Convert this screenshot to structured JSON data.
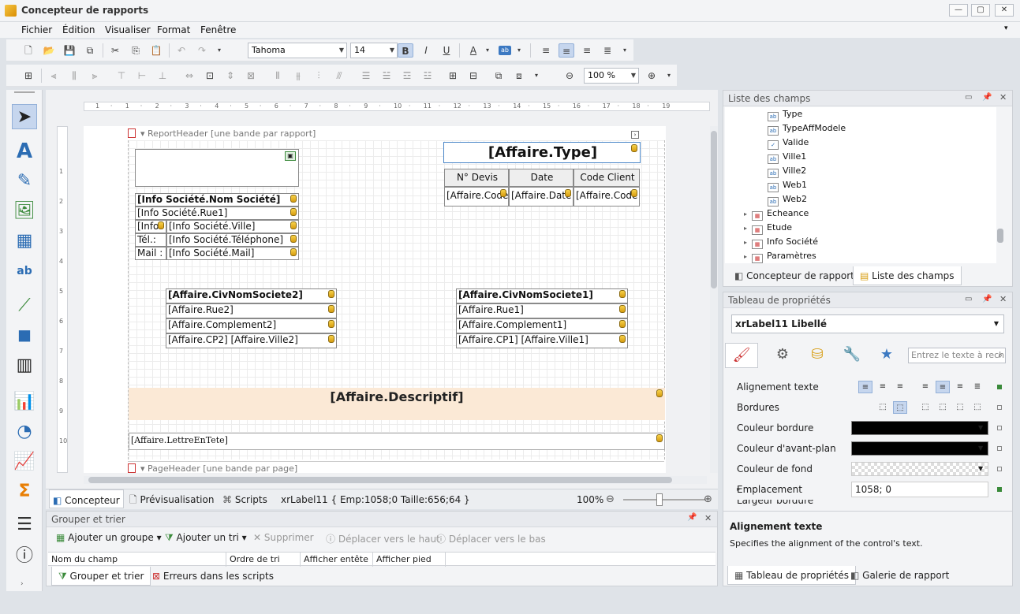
{
  "window": {
    "title": "Concepteur de rapports"
  },
  "menu": [
    "Fichier",
    "Édition",
    "Visualiser",
    "Format",
    "Fenêtre"
  ],
  "toolbar": {
    "font": "Tahoma",
    "size": "14",
    "zoom": "100 %"
  },
  "bands": {
    "report_header": "ReportHeader [une bande par rapport]",
    "page_header": "PageHeader [une bande par page]"
  },
  "report": {
    "title": "[Affaire.Type]",
    "table_headers": [
      "N° Devis",
      "Date",
      "Code Client"
    ],
    "table_cells": [
      "[Affaire.Code",
      "[Affaire.Date",
      "[Affaire.Code"
    ],
    "company": [
      "[Info Société.Nom Société]",
      "[Info Société.Rue1]",
      "[Info",
      "[Info Société.Ville]",
      "Tél.:",
      "[Info Société.Téléphone]",
      "Mail :",
      "[Info Société.Mail]"
    ],
    "left_addr": [
      "[Affaire.CivNomSociete2]",
      "[Affaire.Rue2]",
      "[Affaire.Complement2]",
      "[Affaire.CP2] [Affaire.Ville2]"
    ],
    "right_addr": [
      "[Affaire.CivNomSociete1]",
      "[Affaire.Rue1]",
      "[Affaire.Complement1]",
      "[Affaire.CP1] [Affaire.Ville1]"
    ],
    "descriptif": "[Affaire.Descriptif]",
    "lettre": "[Affaire.LettreEnTete]"
  },
  "status": {
    "tabs": [
      "Concepteur",
      "Prévisualisation",
      "Scripts"
    ],
    "info": "xrLabel11 { Emp:1058;0 Taille:656;64 }",
    "zoom": "100%"
  },
  "group_sort": {
    "title": "Grouper et trier",
    "actions": [
      "Ajouter un groupe",
      "Ajouter un tri",
      "Supprimer",
      "Déplacer vers le haut",
      "Déplacer vers le bas"
    ],
    "columns": [
      "Nom du champ",
      "Ordre de tri",
      "Afficher entête",
      "Afficher pied"
    ],
    "tabs": [
      "Grouper et trier",
      "Erreurs dans les scripts"
    ]
  },
  "field_list": {
    "title": "Liste des champs",
    "fields": [
      "Type",
      "TypeAffModele",
      "Valide",
      "Ville1",
      "Ville2",
      "Web1",
      "Web2"
    ],
    "tables": [
      "Echeance",
      "Etude",
      "Info Société",
      "Paramètres"
    ],
    "tabs": [
      "Concepteur de rapports",
      "Liste des champs"
    ]
  },
  "props": {
    "title": "Tableau de propriétés",
    "selected": "xrLabel11   Libellé",
    "search_placeholder": "Entrez le texte à rech",
    "rows": [
      "Alignement texte",
      "Bordures",
      "Couleur bordure",
      "Couleur d'avant-plan",
      "Couleur de fond",
      "Emplacement",
      "Largeur bordure"
    ],
    "emplacement": "1058; 0",
    "desc_title": "Alignement texte",
    "desc_text": "Specifies the alignment of the control's text.",
    "tabs": [
      "Tableau de propriétés",
      "Galerie de rapport"
    ]
  },
  "ruler_h": [
    "1",
    "·",
    "1",
    "·",
    "2",
    "·",
    "3",
    "·",
    "4",
    "·",
    "5",
    "·",
    "6",
    "·",
    "7",
    "·",
    "8",
    "·",
    "9",
    "·",
    "10",
    "·",
    "11",
    "·",
    "12",
    "·",
    "13",
    "·",
    "14",
    "·",
    "15",
    "·",
    "16",
    "·",
    "17",
    "·",
    "18",
    "·",
    "19"
  ],
  "ruler_v": [
    "1",
    "2",
    "3",
    "4",
    "5",
    "6",
    "7",
    "8",
    "9",
    "10"
  ]
}
